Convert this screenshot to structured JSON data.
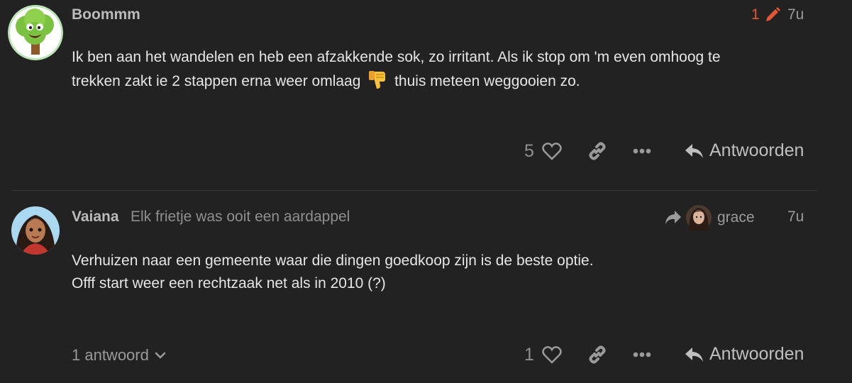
{
  "posts": [
    {
      "username": "Boommm",
      "edit_count": "1",
      "date": "7u",
      "body_line1": "Ik ben aan het wandelen en heb een afzakkende sok, zo irritant. Als ik stop om 'm even omhoog te",
      "body_line2_before": "trekken zakt ie 2 stappen erna weer omlaag",
      "body_emoji": "thumbs-down-emoji",
      "body_line2_after": "thuis meteen weggooien zo.",
      "like_count": "5",
      "reply_label": "Antwoorden",
      "avatar": "tree-avatar"
    },
    {
      "username": "Vaiana",
      "user_title": "Elk frietje was ooit een aardappel",
      "reply_to_user": "grace",
      "date": "7u",
      "body_line1": "Verhuizen naar een gemeente waar die dingen goedkoop zijn is de beste optie.",
      "body_line2": "Offf start weer een rechtzaak net als in 2010 (?)",
      "like_count": "1",
      "reply_label": "Antwoorden",
      "replies_toggle": "1 antwoord",
      "avatar": "vaiana-avatar"
    }
  ],
  "colors": {
    "background": "#222222",
    "accent_edit": "#e45735",
    "muted": "#8f8f8f",
    "text": "#e6e6e6"
  }
}
